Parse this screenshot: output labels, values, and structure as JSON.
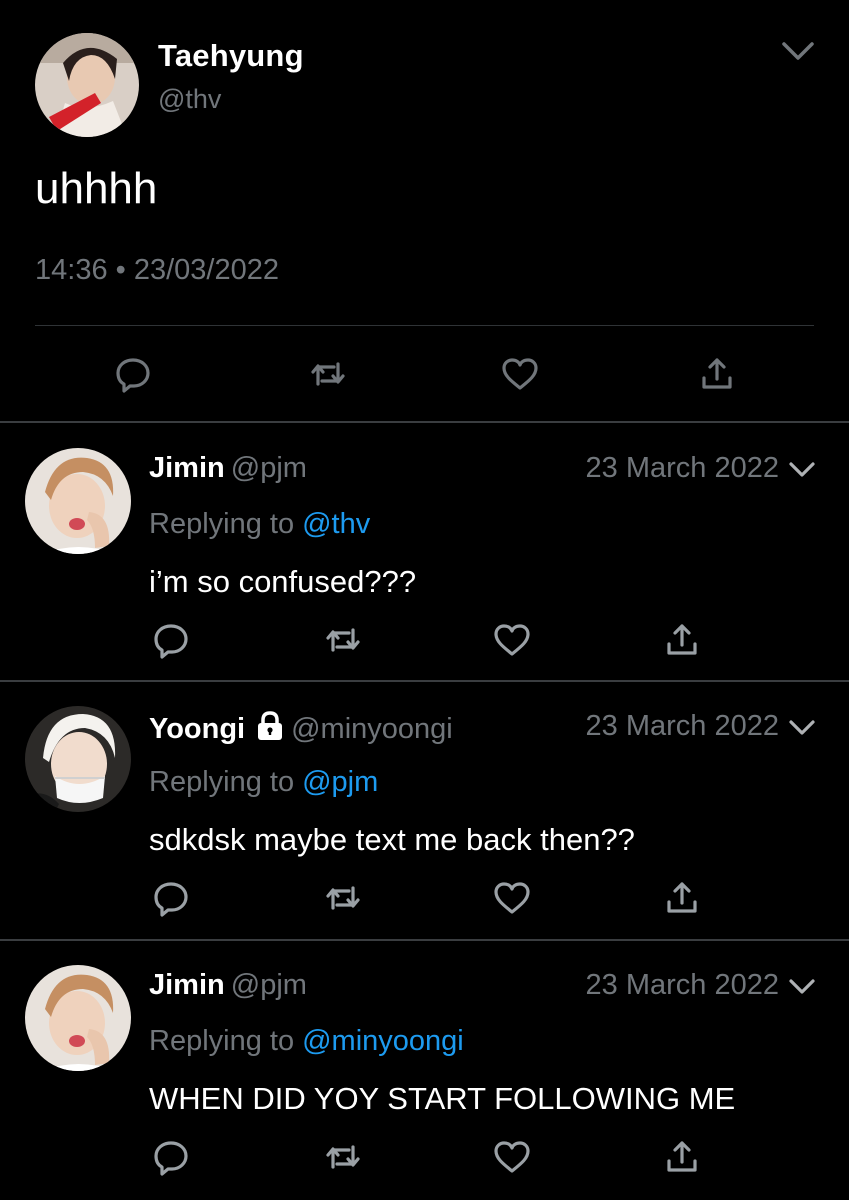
{
  "main_tweet": {
    "author_name": "Taehyung",
    "handle": "@thv",
    "text": "uhhhh",
    "time": "14:36",
    "separator": "•",
    "date": "23/03/2022",
    "avatar_icon": "profile-photo-taehyung",
    "menu_icon": "chevron-down-icon"
  },
  "replies": [
    {
      "author_name": "Jimin",
      "handle": "@pjm",
      "date": "23 March 2022",
      "replying_label": "Replying to",
      "replying_to": "@thv",
      "text": "i’m so confused???",
      "protected": false
    },
    {
      "author_name": "Yoongi",
      "handle": "@minyoongi",
      "date": "23 March 2022",
      "replying_label": "Replying to",
      "replying_to": "@pjm",
      "text": "sdkdsk maybe text me back then??",
      "protected": true
    },
    {
      "author_name": "Jimin",
      "handle": "@pjm",
      "date": "23 March 2022",
      "replying_label": "Replying to",
      "replying_to": "@minyoongi",
      "text": "WHEN DID YOY START FOLLOWING ME",
      "protected": false
    }
  ],
  "icons": {
    "reply": "reply-bubble-icon",
    "retweet": "retweet-icon",
    "like": "heart-icon",
    "share": "share-icon",
    "lock": "lock-icon"
  },
  "colors": {
    "background": "#000000",
    "text_primary": "#ffffff",
    "text_secondary": "#71767b",
    "link": "#1d9bf0",
    "divider": "#2f3336"
  }
}
